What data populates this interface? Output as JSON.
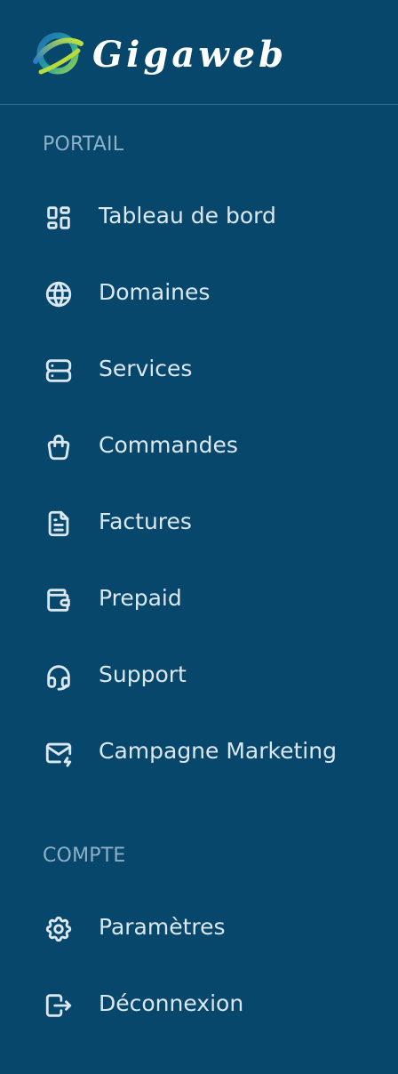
{
  "brand": {
    "name": "Gigaweb"
  },
  "sections": {
    "portail": {
      "label": "PORTAIL",
      "items": [
        {
          "label": "Tableau de bord",
          "icon": "dashboard-icon"
        },
        {
          "label": "Domaines",
          "icon": "globe-icon"
        },
        {
          "label": "Services",
          "icon": "server-icon"
        },
        {
          "label": "Commandes",
          "icon": "shopping-bag-icon"
        },
        {
          "label": "Factures",
          "icon": "invoice-icon"
        },
        {
          "label": "Prepaid",
          "icon": "wallet-icon"
        },
        {
          "label": "Support",
          "icon": "headset-icon"
        },
        {
          "label": "Campagne Marketing",
          "icon": "mail-bolt-icon"
        }
      ]
    },
    "compte": {
      "label": "COMPTE",
      "items": [
        {
          "label": "Paramètres",
          "icon": "gear-icon"
        },
        {
          "label": "Déconnexion",
          "icon": "logout-icon"
        }
      ]
    }
  },
  "colors": {
    "background": "#06476b",
    "text": "#dce8f1",
    "section_label": "#8fb0c6",
    "divider": "#2f6a8b"
  }
}
